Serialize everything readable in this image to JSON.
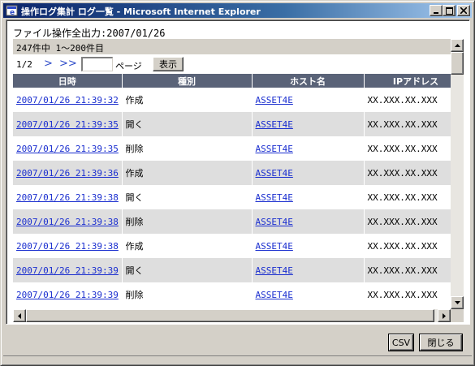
{
  "window": {
    "title": "操作ログ集計 ログ一覧 - Microsoft Internet Explorer"
  },
  "page": {
    "export_line": "ファイル操作全出力:2007/01/26",
    "count_line": "247件中 1～200件目"
  },
  "pager": {
    "page": "1/2",
    "next": ">",
    "last": ">>",
    "input_value": "",
    "label": "ページ",
    "show_button": "表示"
  },
  "table": {
    "headers": [
      "日時",
      "種別",
      "ホスト名",
      "IPアドレス"
    ],
    "rows": [
      {
        "datetime": "2007/01/26 21:39:32",
        "type": "作成",
        "host": "ASSET4E",
        "ip": "XX.XXX.XX.XXX"
      },
      {
        "datetime": "2007/01/26 21:39:35",
        "type": "開く",
        "host": "ASSET4E",
        "ip": "XX.XXX.XX.XXX"
      },
      {
        "datetime": "2007/01/26 21:39:35",
        "type": "削除",
        "host": "ASSET4E",
        "ip": "XX.XXX.XX.XXX"
      },
      {
        "datetime": "2007/01/26 21:39:36",
        "type": "作成",
        "host": "ASSET4E",
        "ip": "XX.XXX.XX.XXX"
      },
      {
        "datetime": "2007/01/26 21:39:38",
        "type": "開く",
        "host": "ASSET4E",
        "ip": "XX.XXX.XX.XXX"
      },
      {
        "datetime": "2007/01/26 21:39:38",
        "type": "削除",
        "host": "ASSET4E",
        "ip": "XX.XXX.XX.XXX"
      },
      {
        "datetime": "2007/01/26 21:39:38",
        "type": "作成",
        "host": "ASSET4E",
        "ip": "XX.XXX.XX.XXX"
      },
      {
        "datetime": "2007/01/26 21:39:39",
        "type": "開く",
        "host": "ASSET4E",
        "ip": "XX.XXX.XX.XXX"
      },
      {
        "datetime": "2007/01/26 21:39:39",
        "type": "削除",
        "host": "ASSET4E",
        "ip": "XX.XXX.XX.XXX"
      }
    ]
  },
  "footer": {
    "csv_button": "CSV",
    "close_button": "閉じる"
  },
  "colors": {
    "title_gradient_start": "#0a246a",
    "header_bg": "#5a6378",
    "link": "#1a2ecf",
    "row_alt": "#dedede"
  }
}
